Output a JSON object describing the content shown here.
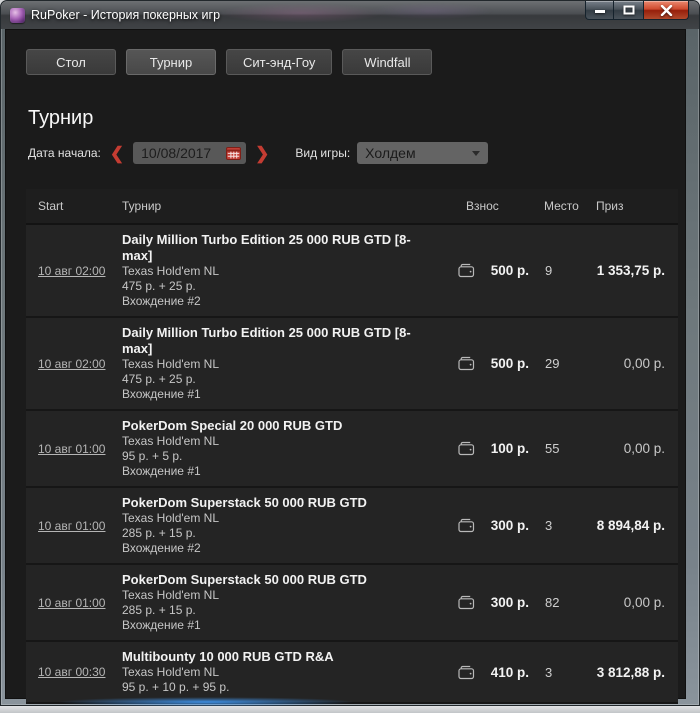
{
  "window": {
    "title": "RuPoker - История покерных игр",
    "controls": {
      "minimize": "minimize",
      "maximize": "maximize",
      "close": "close"
    }
  },
  "tabs": [
    {
      "label": "Стол",
      "active": false
    },
    {
      "label": "Турнир",
      "active": true
    },
    {
      "label": "Сит-энд-Гоу",
      "active": false
    },
    {
      "label": "Windfall",
      "active": false
    }
  ],
  "page": {
    "title": "Турнир"
  },
  "filters": {
    "date_label": "Дата начала:",
    "prev_icon": "❮",
    "date_value": "10/08/2017",
    "next_icon": "❯",
    "game_type_label": "Вид игры:",
    "game_type_value": "Холдем"
  },
  "table": {
    "headers": {
      "start": "Start",
      "tournament": "Турнир",
      "buyin": "Взнос",
      "place": "Место",
      "prize": "Приз"
    },
    "rows": [
      {
        "start": "10 авг 02:00",
        "title": "Daily Million Turbo Edition 25 000 RUB GTD [8-max]",
        "game": "Texas Hold'em NL",
        "breakdown": "475 р. + 25 р.",
        "entry": "Вхождение #2",
        "buyin": "500 р.",
        "place": "9",
        "prize": "1 353,75 р.",
        "prize_bold": true
      },
      {
        "start": "10 авг 02:00",
        "title": "Daily Million Turbo Edition 25 000 RUB GTD [8-max]",
        "game": "Texas Hold'em NL",
        "breakdown": "475 р. + 25 р.",
        "entry": "Вхождение #1",
        "buyin": "500 р.",
        "place": "29",
        "prize": "0,00 р.",
        "prize_bold": false
      },
      {
        "start": "10 авг 01:00",
        "title": "PokerDom Special 20 000 RUB GTD",
        "game": "Texas Hold'em NL",
        "breakdown": "95 р. + 5 р.",
        "entry": "Вхождение #1",
        "buyin": "100 р.",
        "place": "55",
        "prize": "0,00 р.",
        "prize_bold": false
      },
      {
        "start": "10 авг 01:00",
        "title": "PokerDom Superstack 50 000 RUB GTD",
        "game": "Texas Hold'em NL",
        "breakdown": "285 р. + 15 р.",
        "entry": "Вхождение #2",
        "buyin": "300 р.",
        "place": "3",
        "prize": "8 894,84 р.",
        "prize_bold": true
      },
      {
        "start": "10 авг 01:00",
        "title": "PokerDom Superstack 50 000 RUB GTD",
        "game": "Texas Hold'em NL",
        "breakdown": "285 р. + 15 р.",
        "entry": "Вхождение #1",
        "buyin": "300 р.",
        "place": "82",
        "prize": "0,00 р.",
        "prize_bold": false
      },
      {
        "start": "10 авг 00:30",
        "title": "Multibounty 10 000 RUB GTD R&A",
        "game": "Texas Hold'em NL",
        "breakdown": "95 р. + 10 р. + 95 р.",
        "entry": "",
        "buyin": "410 р.",
        "place": "3",
        "prize": "3 812,88 р.",
        "prize_bold": true
      }
    ]
  },
  "icons": {
    "app": "rupoker-logo",
    "calendar": "calendar-grid",
    "wallet": "wallet-outline",
    "dropdown_arrow": "triangle-down"
  },
  "colors": {
    "accent_red": "#c43c32",
    "client_bg": "#1b1b1b",
    "row_bg": "#242424",
    "close_button_red": "#b1492c"
  }
}
